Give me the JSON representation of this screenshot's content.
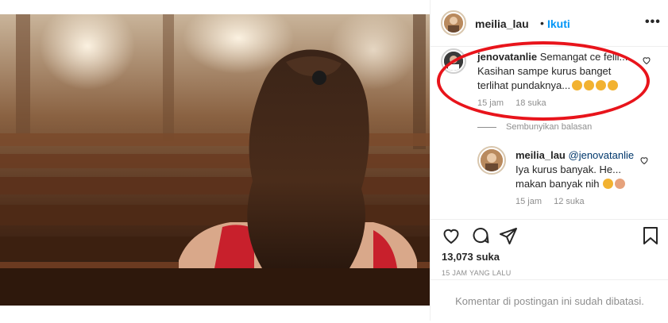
{
  "post": {
    "author": "meilia_lau",
    "follow_label": "Ikuti",
    "separator": "•"
  },
  "comment": {
    "author": "jenovatanlie",
    "line1": "Semangat ce felli...",
    "line2": "Kasihan sampe kurus banget",
    "line3": "terlihat pundaknya...",
    "emojis": [
      "heart-eyes-emoji",
      "heart-eyes-emoji",
      "heart-eyes-emoji",
      "heart-eyes-emoji"
    ],
    "time": "15 jam",
    "likes": "18 suka"
  },
  "hide_replies_label": "Sembunyikan balasan",
  "reply": {
    "author": "meilia_lau",
    "mention": "@jenovatanlie",
    "line1_rest": "Iya kurus banyak. He...",
    "line2": "makan banyak nih",
    "emojis": [
      "smile-emoji",
      "raising-hand-emoji"
    ],
    "time": "15 jam",
    "likes": "12 suka"
  },
  "actions": {
    "like_count": "13,073 suka",
    "time_ago": "15 JAM YANG LALU"
  },
  "comments_closed": "Komentar di postingan ini sudah dibatasi.",
  "colors": {
    "accent": "#0095f6",
    "annotation": "#e8141b",
    "muted": "#8e8e8e"
  }
}
